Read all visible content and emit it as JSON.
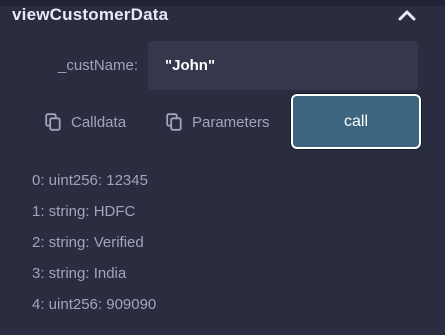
{
  "function": {
    "name": "viewCustomerData",
    "collapse_icon": "chevron-up-icon"
  },
  "input": {
    "label": "_custName:",
    "value": "\"John\""
  },
  "actions": {
    "calldata_label": "Calldata",
    "calldata_icon": "copy-icon",
    "parameters_label": "Parameters",
    "parameters_icon": "copy-icon",
    "call_label": "call"
  },
  "results": [
    "0: uint256: 12345",
    "1: string: HDFC",
    "2: string: Verified",
    "3: string: India",
    "4: uint256: 909090"
  ],
  "colors": {
    "background": "#2a2c3f",
    "input_bg": "#35374d",
    "call_button_bg": "#3d6580",
    "text_muted": "#a2a3bd",
    "text_bright": "#e8e9f5"
  }
}
